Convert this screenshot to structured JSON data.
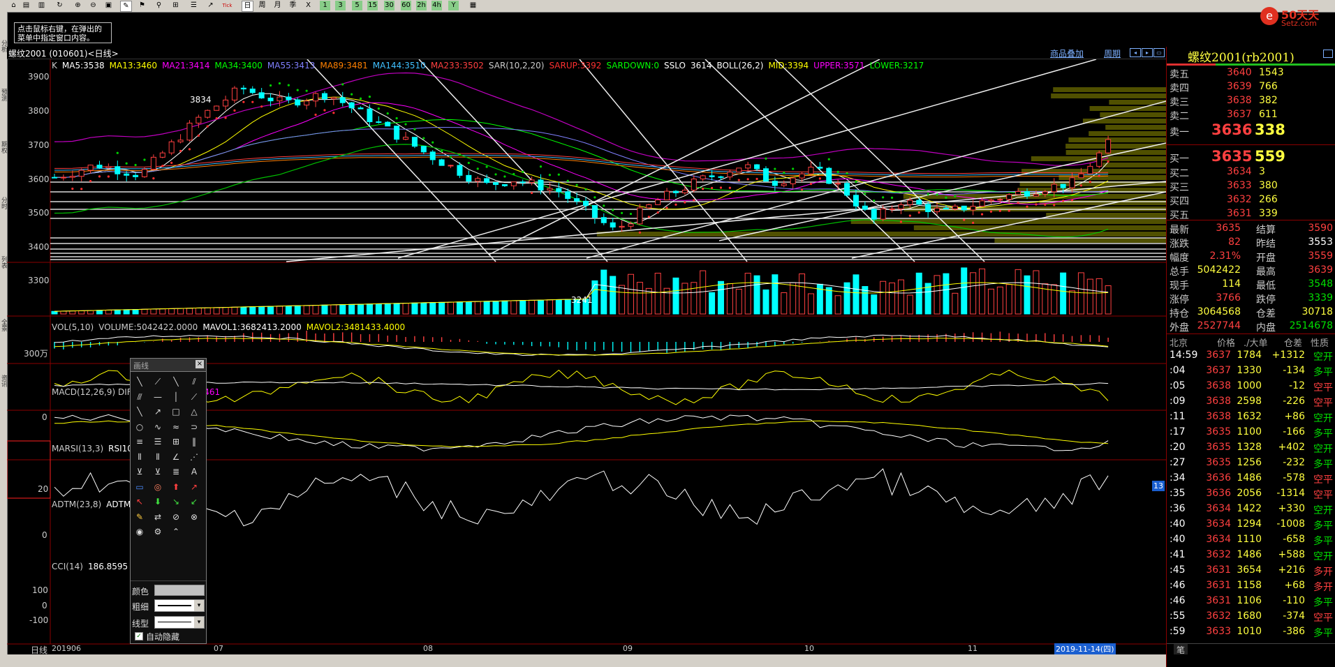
{
  "toolbar": {
    "buttons": [
      "home-icon",
      "folder-icon",
      "book-icon",
      "refresh-icon",
      "zoom-in-icon",
      "zoom-out-icon",
      "window-icon",
      "pen-icon",
      "flag-icon",
      "tick-icon",
      "brush-icon",
      "pin-icon",
      "list-icon",
      "chart-icon",
      "day",
      "week",
      "month",
      "quarter",
      "x",
      "1",
      "3",
      "5",
      "15",
      "30",
      "60",
      "2h",
      "4h",
      "y",
      "calc-icon"
    ],
    "labels": {
      "tick": "Tick",
      "day": "日",
      "week": "周",
      "month": "月",
      "quarter": "季",
      "x": "X",
      "one": "1",
      "three": "3",
      "five": "5",
      "fifteen": "15",
      "thirty": "30",
      "sixty": "60",
      "twoh": "2h",
      "fourh": "4h",
      "year": "Y"
    }
  },
  "logo": {
    "text": "50天天",
    "sub": "Setz.com"
  },
  "hint": {
    "line1": "点击鼠标右键，在弹出的",
    "line2": "菜单中指定窗口内容。"
  },
  "left_tabs": [
    "分析",
    "预测",
    "期权",
    "分时",
    "列表",
    "全景",
    "资讯",
    "通信"
  ],
  "header": {
    "title": "螺纹2001 (010601)<日线>",
    "overlay_link": "商品叠加",
    "period_link": "周期"
  },
  "main_legend": [
    {
      "text": "K",
      "color": "#cccccc"
    },
    {
      "text": "MA5:3538",
      "color": "#ffffff"
    },
    {
      "text": "MA13:3460",
      "color": "#ffff00"
    },
    {
      "text": "MA21:3414",
      "color": "#ff00ff"
    },
    {
      "text": "MA34:3400",
      "color": "#00ff00"
    },
    {
      "text": "MA55:3413",
      "color": "#8080ff"
    },
    {
      "text": "MA89:3481",
      "color": "#ff8000"
    },
    {
      "text": "MA144:3510",
      "color": "#40c0ff"
    },
    {
      "text": "MA233:3502",
      "color": "#ff4040"
    },
    {
      "text": "SAR(10,2,20)",
      "color": "#cccccc"
    },
    {
      "text": "SARUP:3392",
      "color": "#ff3030"
    },
    {
      "text": "SARDOWN:0",
      "color": "#00ff00"
    },
    {
      "text": "SSLO",
      "color": "#ffffff"
    },
    {
      "text": "3614",
      "color": "#ffffff"
    },
    {
      "text": "BOLL(26,2)",
      "color": "#ffffff"
    },
    {
      "text": "MID:3394",
      "color": "#ffff00"
    },
    {
      "text": "UPPER:3571",
      "color": "#ff00ff"
    },
    {
      "text": "LOWER:3217",
      "color": "#00ff00"
    }
  ],
  "price_axis": [
    "3900",
    "3800",
    "3700",
    "3600",
    "3500",
    "3400",
    "3300"
  ],
  "price_marks": {
    "high": "3834",
    "low": "3241"
  },
  "vol_legend": [
    {
      "text": "VOL(5,10)",
      "color": "#cccccc"
    },
    {
      "text": "VOLUME:5042422.0000",
      "color": "#cccccc"
    },
    {
      "text": "MAVOL1:3682413.2000",
      "color": "#ffffff"
    },
    {
      "text": "MAVOL2:3481433.4000",
      "color": "#ffff00"
    }
  ],
  "vol_axis": "300万",
  "macd_legend": [
    {
      "text": "MACD(12,26,9) DIF",
      "color": "#cccccc"
    },
    {
      "text": "271",
      "color": "#ffff00"
    },
    {
      "text": "MACD:53.4461",
      "color": "#ff00ff"
    }
  ],
  "macd_axis": "0",
  "marsi_legend": [
    {
      "text": "MARSI(13,3)",
      "color": "#cccccc"
    },
    {
      "text": "RSI10:",
      "color": "#ffffff"
    },
    {
      "text": "71",
      "color": "#ffff00"
    }
  ],
  "marsi_axis": "20",
  "marsi_badge": "13",
  "adtm_legend": [
    {
      "text": "ADTM(23,8)",
      "color": "#cccccc"
    },
    {
      "text": "ADTM:",
      "color": "#ffffff"
    }
  ],
  "adtm_axis": "0",
  "cci_legend": [
    {
      "text": "CCI(14)",
      "color": "#cccccc"
    },
    {
      "text": "186.8595",
      "color": "#ffffff"
    }
  ],
  "cci_axis": [
    "100",
    "0",
    "-100"
  ],
  "x_axis": {
    "period": "日线",
    "labels": [
      "201906",
      "07",
      "08",
      "09",
      "10",
      "11"
    ],
    "cursor_date": "2019-11-14(四)"
  },
  "draw_panel": {
    "title": "画线",
    "color_label": "颜色",
    "width_label": "粗细",
    "style_label": "线型",
    "auto_hide_label": "自动隐藏",
    "tools": [
      "line-icon",
      "segment-icon",
      "ray-icon",
      "parallel-icon",
      "channel-icon",
      "hline-icon",
      "vline-icon",
      "arrow-line-icon",
      "trend-icon",
      "arrow-icon",
      "rect-icon",
      "triangle-icon",
      "ellipse-icon",
      "wave-icon",
      "curve-icon",
      "arc-icon",
      "fib-icon",
      "gann-icon",
      "cycle-icon",
      "fib-time-icon",
      "bars-icon",
      "bars2-icon",
      "angle-icon",
      "fan-icon",
      "speed-icon",
      "speed2-icon",
      "golden-icon",
      "text-icon",
      "ruler-icon",
      "target-icon",
      "up-arrow-icon",
      "upright-arrow-icon",
      "upleft-arrow-icon",
      "down-arrow-icon",
      "downright-arrow-icon",
      "downleft-arrow-icon",
      "highlight-icon",
      "swap-icon",
      "hide-icon",
      "hide-all-icon",
      "eye-icon",
      "gear-icon",
      "collapse-icon"
    ]
  },
  "quote": {
    "title": "螺纹2001(rb2001)",
    "asks": [
      {
        "label": "卖五",
        "price": "3640",
        "vol": "1543"
      },
      {
        "label": "卖四",
        "price": "3639",
        "vol": "766"
      },
      {
        "label": "卖三",
        "price": "3638",
        "vol": "382"
      },
      {
        "label": "卖二",
        "price": "3637",
        "vol": "611"
      },
      {
        "label": "卖一",
        "price": "3636",
        "vol": "338"
      }
    ],
    "bids": [
      {
        "label": "买一",
        "price": "3635",
        "vol": "559"
      },
      {
        "label": "买二",
        "price": "3634",
        "vol": "3"
      },
      {
        "label": "买三",
        "price": "3633",
        "vol": "380"
      },
      {
        "label": "买四",
        "price": "3632",
        "vol": "266"
      },
      {
        "label": "买五",
        "price": "3631",
        "vol": "339"
      }
    ],
    "stats": [
      {
        "l1": "最新",
        "v1": "3635",
        "c1": "red",
        "l2": "结算",
        "v2": "3590",
        "c2": "red"
      },
      {
        "l1": "涨跌",
        "v1": "82",
        "c1": "red",
        "l2": "昨结",
        "v2": "3553",
        "c2": "white"
      },
      {
        "l1": "幅度",
        "v1": "2.31%",
        "c1": "red",
        "l2": "开盘",
        "v2": "3559",
        "c2": "red"
      },
      {
        "l1": "总手",
        "v1": "5042422",
        "c1": "yellow",
        "l2": "最高",
        "v2": "3639",
        "c2": "red"
      },
      {
        "l1": "现手",
        "v1": "114",
        "c1": "yellow",
        "l2": "最低",
        "v2": "3548",
        "c2": "green"
      },
      {
        "l1": "涨停",
        "v1": "3766",
        "c1": "red",
        "l2": "跌停",
        "v2": "3339",
        "c2": "green"
      },
      {
        "l1": "持仓",
        "v1": "3064568",
        "c1": "yellow",
        "l2": "仓差",
        "v2": "30718",
        "c2": "yellow"
      },
      {
        "l1": "外盘",
        "v1": "2527744",
        "c1": "red",
        "l2": "内盘",
        "v2": "2514678",
        "c2": "green"
      }
    ],
    "ticks_header": {
      "time": "北京",
      "price": "价格",
      "vol": "./大单",
      "oi": "仓差",
      "nature": "性质"
    },
    "ticks": [
      {
        "t": "14:59",
        "p": "3637",
        "v": "1784",
        "oi": "+1312",
        "n": "空开",
        "nc": "green"
      },
      {
        "t": ":04",
        "p": "3637",
        "v": "1330",
        "oi": "-134",
        "n": "多平",
        "nc": "green"
      },
      {
        "t": ":05",
        "p": "3638",
        "v": "1000",
        "oi": "-12",
        "n": "空平",
        "nc": "red"
      },
      {
        "t": ":09",
        "p": "3638",
        "v": "2598",
        "oi": "-226",
        "n": "空平",
        "nc": "red"
      },
      {
        "t": ":11",
        "p": "3638",
        "v": "1632",
        "oi": "+86",
        "n": "空开",
        "nc": "green"
      },
      {
        "t": ":17",
        "p": "3635",
        "v": "1100",
        "oi": "-166",
        "n": "多平",
        "nc": "green"
      },
      {
        "t": ":20",
        "p": "3635",
        "v": "1328",
        "oi": "+402",
        "n": "空开",
        "nc": "green"
      },
      {
        "t": ":27",
        "p": "3635",
        "v": "1256",
        "oi": "-232",
        "n": "多平",
        "nc": "green"
      },
      {
        "t": ":34",
        "p": "3636",
        "v": "1486",
        "oi": "-578",
        "n": "空平",
        "nc": "red"
      },
      {
        "t": ":35",
        "p": "3636",
        "v": "2056",
        "oi": "-1314",
        "n": "空平",
        "nc": "red"
      },
      {
        "t": ":36",
        "p": "3634",
        "v": "1422",
        "oi": "+330",
        "n": "空开",
        "nc": "green"
      },
      {
        "t": ":40",
        "p": "3634",
        "v": "1294",
        "oi": "-1008",
        "n": "多平",
        "nc": "green"
      },
      {
        "t": ":40",
        "p": "3634",
        "v": "1110",
        "oi": "-658",
        "n": "多平",
        "nc": "green"
      },
      {
        "t": ":41",
        "p": "3632",
        "v": "1486",
        "oi": "+588",
        "n": "空开",
        "nc": "green"
      },
      {
        "t": ":45",
        "p": "3631",
        "v": "3654",
        "oi": "+216",
        "n": "多开",
        "nc": "red"
      },
      {
        "t": ":46",
        "p": "3631",
        "v": "1158",
        "oi": "+68",
        "n": "多开",
        "nc": "red"
      },
      {
        "t": ":46",
        "p": "3631",
        "v": "1106",
        "oi": "-110",
        "n": "多平",
        "nc": "green"
      },
      {
        "t": ":55",
        "p": "3632",
        "v": "1680",
        "oi": "-374",
        "n": "空平",
        "nc": "red"
      },
      {
        "t": ":59",
        "p": "3633",
        "v": "1010",
        "oi": "-386",
        "n": "多平",
        "nc": "green"
      }
    ],
    "footer_tab": "笔"
  }
}
